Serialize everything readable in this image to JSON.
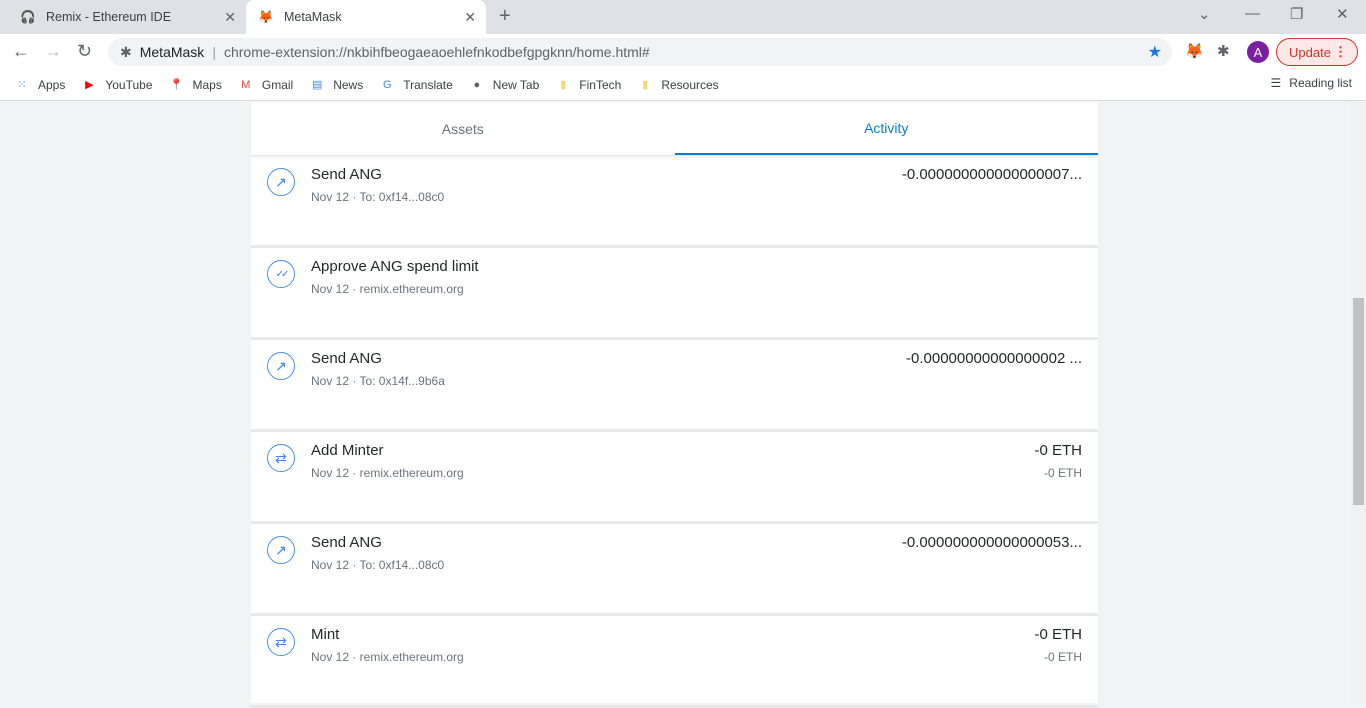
{
  "browser": {
    "tabs": [
      {
        "title": "Remix - Ethereum IDE",
        "icon": "remix-icon"
      },
      {
        "title": "MetaMask",
        "icon": "metamask-fox-icon",
        "active": true
      }
    ],
    "omnibox": {
      "site": "MetaMask",
      "url": "chrome-extension://nkbihfbeogaeaoehlefnkodbefgpgknn/home.html#"
    },
    "avatar": "A",
    "update_label": "Update",
    "bookmarks": [
      {
        "label": "Apps",
        "icon": "apps-grid-icon"
      },
      {
        "label": "YouTube",
        "icon": "youtube-icon"
      },
      {
        "label": "Maps",
        "icon": "maps-icon"
      },
      {
        "label": "Gmail",
        "icon": "gmail-icon"
      },
      {
        "label": "News",
        "icon": "news-icon"
      },
      {
        "label": "Translate",
        "icon": "translate-icon"
      },
      {
        "label": "New Tab",
        "icon": "globe-icon"
      },
      {
        "label": "FinTech",
        "icon": "folder-icon"
      },
      {
        "label": "Resources",
        "icon": "folder-icon"
      }
    ],
    "reading_list": "Reading list"
  },
  "metamask": {
    "tabs": [
      {
        "label": "Assets"
      },
      {
        "label": "Activity",
        "active": true
      }
    ],
    "accent": "#037dd6",
    "activity": [
      {
        "icon": "send-arrow-icon",
        "title": "Send ANG",
        "sub": "Nov 12 · To: 0xf14...08c0",
        "amount": "-0.000000000000000007...",
        "amount2": ""
      },
      {
        "icon": "approve-check-icon",
        "title": "Approve ANG spend limit",
        "sub": "Nov 12 · remix.ethereum.org",
        "amount": "",
        "amount2": ""
      },
      {
        "icon": "send-arrow-icon",
        "title": "Send ANG",
        "sub": "Nov 12 · To: 0x14f...9b6a",
        "amount": "-0.00000000000000002 ...",
        "amount2": ""
      },
      {
        "icon": "interaction-swap-icon",
        "title": "Add Minter",
        "sub": "Nov 12 · remix.ethereum.org",
        "amount": "-0 ETH",
        "amount2": "-0 ETH"
      },
      {
        "icon": "send-arrow-icon",
        "title": "Send ANG",
        "sub": "Nov 12 · To: 0xf14...08c0",
        "amount": "-0.000000000000000053...",
        "amount2": ""
      },
      {
        "icon": "interaction-swap-icon",
        "title": "Mint",
        "sub": "Nov 12 · remix.ethereum.org",
        "amount": "-0 ETH",
        "amount2": "-0 ETH"
      }
    ]
  }
}
